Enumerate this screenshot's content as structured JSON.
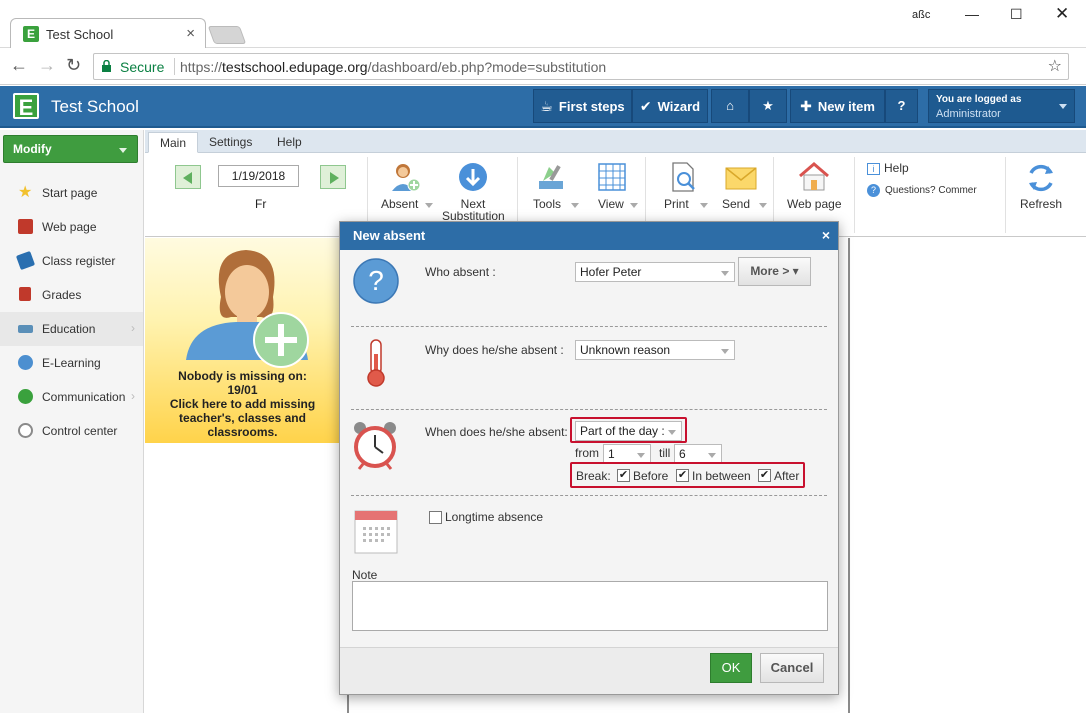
{
  "browser": {
    "tab_title": "Test School",
    "tab_close": "×",
    "favicon_letter": "E",
    "window_ab": "aßc",
    "win_min": "—",
    "win_max": "☐",
    "win_close": "✕",
    "secure_label": "Secure",
    "url_prefix": "https://",
    "url_domain": "testschool.edupage.org",
    "url_path": "/dashboard/eb.php?mode=substitution"
  },
  "header": {
    "logo_letter": "E",
    "title": "Test School",
    "first_steps": "First steps",
    "wizard": "Wizard",
    "new_item": "New item",
    "help": "?",
    "logged_line1": "You are logged as",
    "logged_line2": "Administrator"
  },
  "sidebar": {
    "modify_label": "Modify",
    "items": [
      {
        "label": "Start page",
        "icon": "star-icon",
        "color": "#f2c12e"
      },
      {
        "label": "Web page",
        "icon": "web-page-icon",
        "color": "#c0392b"
      },
      {
        "label": "Class register",
        "icon": "class-register-icon",
        "color": "#2a6fb0"
      },
      {
        "label": "Grades",
        "icon": "grades-icon",
        "color": "#c0392b"
      },
      {
        "label": "Education",
        "icon": "education-icon",
        "color": "#5a8fb8"
      },
      {
        "label": "E-Learning",
        "icon": "e-learning-icon",
        "color": "#4c8fd0"
      },
      {
        "label": "Communication",
        "icon": "communication-icon",
        "color": "#3aa13d"
      },
      {
        "label": "Control center",
        "icon": "control-center-icon",
        "color": "#8a8a8a"
      }
    ]
  },
  "ribbon": {
    "tabs": [
      "Main",
      "Settings",
      "Help"
    ],
    "date": "1/19/2018",
    "day": "Fr",
    "buttons": {
      "absent": "Absent",
      "next_substitution": "Next Substitution",
      "tools": "Tools",
      "view": "View",
      "print": "Print",
      "send": "Send",
      "web_page": "Web page",
      "refresh": "Refresh"
    },
    "help_label": "Help",
    "questions_label": "Questions? Commer"
  },
  "panel": {
    "line1": "Nobody is missing on:",
    "line2": "19/01",
    "line3": "Click here to add missing",
    "line4": "teacher's, classes and",
    "line5": "classrooms."
  },
  "dialog": {
    "title": "New absent",
    "close": "×",
    "who_label": "Who absent :",
    "who_value": "Hofer Peter",
    "more_label": "More > ▾",
    "why_label": "Why does he/she absent :",
    "why_value": "Unknown reason",
    "when_label": "When does he/she absent:",
    "when_value": "Part of the day :",
    "from_label": "from",
    "from_value": "1",
    "till_label": "till",
    "till_value": "6",
    "break_label": "Break:",
    "break_before": "Before",
    "break_between": "In between",
    "break_after": "After",
    "check_mark": "✔",
    "longtime_label": "Longtime absence",
    "note_label": "Note",
    "ok": "OK",
    "cancel": "Cancel"
  },
  "colors": {
    "header_blue": "#2d6da7",
    "accent_green": "#3f9c3f",
    "highlight_red": "#c8102e"
  }
}
